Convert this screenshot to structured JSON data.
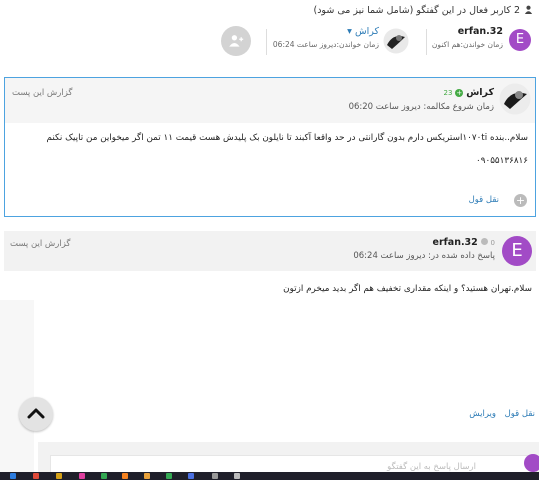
{
  "active_users": {
    "text": "2 کاربر فعال در این گفتگو (شامل شما نیز می شود)"
  },
  "users": [
    {
      "name": "erfan.32",
      "status": "زمان خواندن:هم اکنون",
      "avatar_letter": "E",
      "avatar_color": "#a24bc6"
    },
    {
      "name": "کراش",
      "status": "زمان خواندن:دیروز ساعت 06:24"
    }
  ],
  "posts": [
    {
      "author": "کراش",
      "reputation": "23",
      "meta": "زمان شروع مکالمه: دیروز ساعت 06:20",
      "report_label": "گزارش این پست",
      "body": "سلام..بنده ۱۰۷۰tiاستریکس دارم بدون گارانتی در حد واقعا آکبند تا نایلون بک پلیدش هست قیمت ۱۱ تمن اگر میخواین من تاپیک نکنم",
      "phone": "۰۹۰۵۵۱۳۶۸۱۶",
      "quote_label": "نقل قول"
    },
    {
      "author": "erfan.32",
      "reputation": "0",
      "meta": "پاسخ داده شده در: دیروز ساعت 06:24",
      "report_label": "گزارش این پست",
      "body": "سلام.تهران هستید؟ و اینکه مقداری تخفیف هم اگر بدید میخرم ازتون",
      "quote_label": "نقل قول",
      "edit_label": "ویرایش",
      "avatar_letter": "E"
    }
  ],
  "reply": {
    "placeholder": "ارسال پاسخ به این گفتگو"
  },
  "colors": {
    "accent": "#4da3e0",
    "link": "#2c7bb6",
    "avatar": "#a24bc6"
  }
}
